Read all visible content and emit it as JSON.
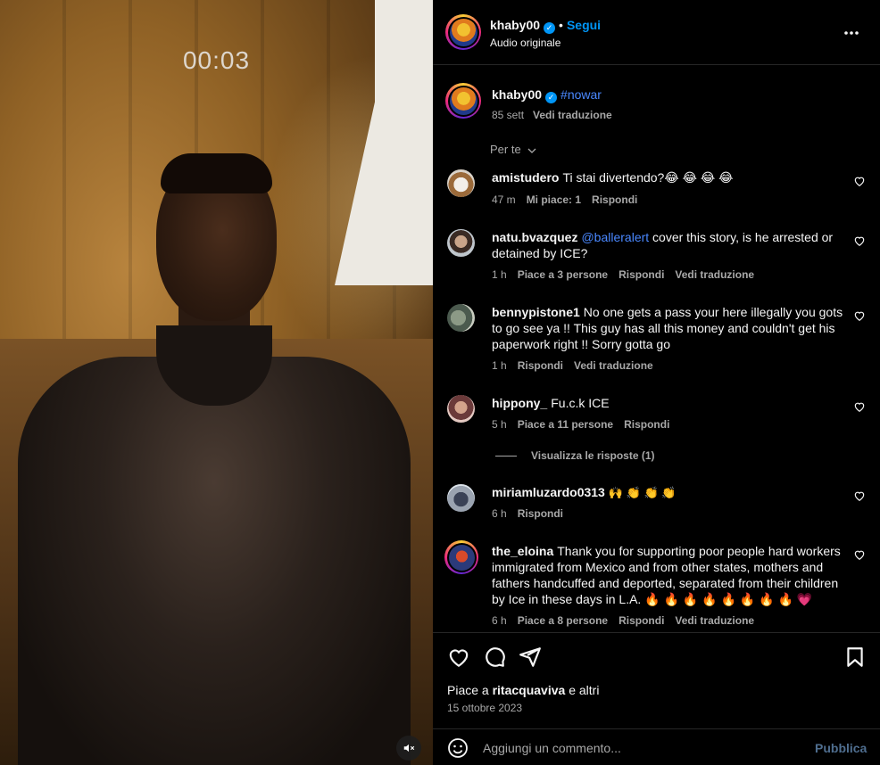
{
  "video": {
    "timer": "00:03",
    "mute_icon": "speaker-muted-icon"
  },
  "post": {
    "author": "khaby00",
    "follow_label": "Segui",
    "audio_label": "Audio originale",
    "more_icon": "more-horizontal-icon",
    "verified_mark": "✓"
  },
  "caption": {
    "author": "khaby00",
    "hashtag": "#nowar",
    "age": "85 sett",
    "translate_label": "Vedi traduzione"
  },
  "sort_label": "Per te",
  "comments": [
    {
      "user": "amistudero",
      "text": "Ti stai divertendo?😂 😂 😂 😂",
      "time": "47 m",
      "likes": "Mi piace: 1",
      "reply": "Rispondi",
      "translate": ""
    },
    {
      "user": "natu.bvazquez",
      "mention": "@balleralert",
      "text": " cover this story, is he arrested or detained by ICE?",
      "time": "1 h",
      "likes": "Piace a 3 persone",
      "reply": "Rispondi",
      "translate": "Vedi traduzione"
    },
    {
      "user": "bennypistone1",
      "text": "No one gets a pass your here illegally you gots to go see ya !! This guy has all this money and couldn't get his paperwork right !! Sorry gotta go",
      "time": "1 h",
      "likes": "",
      "reply": "Rispondi",
      "translate": "Vedi traduzione"
    },
    {
      "user": "hippony_",
      "text": "Fu.c.k ICE",
      "time": "5 h",
      "likes": "Piace a 11 persone",
      "reply": "Rispondi",
      "translate": ""
    },
    {
      "user": "miriamluzardo0313",
      "text": "🙌 👏 👏 👏",
      "time": "6 h",
      "likes": "",
      "reply": "Rispondi",
      "translate": ""
    },
    {
      "user": "the_eloina",
      "text": "Thank you for supporting poor people hard workers immigrated from Mexico and from other states, mothers and fathers handcuffed and deported, separated from their children by Ice in these days in L.A. 🔥 🔥 🔥 🔥 🔥 🔥 🔥 🔥 💗",
      "time": "6 h",
      "likes": "Piace a 8 persone",
      "reply": "Rispondi",
      "translate": "Vedi traduzione"
    }
  ],
  "view_replies": "Visualizza le risposte (1)",
  "likes_line": {
    "prefix": "Piace a ",
    "user": "ritacquaviva",
    "suffix": " e altri"
  },
  "post_date": "15 ottobre 2023",
  "comment_input": {
    "placeholder": "Aggiungi un commento...",
    "publish": "Pubblica"
  },
  "colors": {
    "link": "#0095f6",
    "mention": "#4a88ff",
    "muted": "#a8a8a8",
    "divider": "#262626"
  }
}
